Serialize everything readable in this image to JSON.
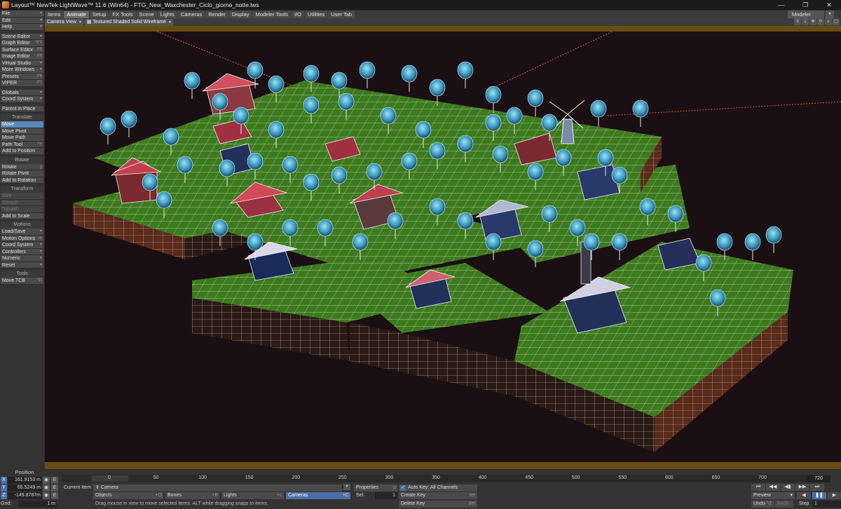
{
  "window": {
    "title": "Layout™ NewTek LightWave™ 11.6 (Win64) - FTG_New_Waxchester_Ciclo_giorno_notte.lws",
    "controls": [
      "—",
      "❐",
      "✕"
    ]
  },
  "tabs": [
    "Items",
    "Animate",
    "Setup",
    "FX Tools",
    "Scene",
    "Lights",
    "Cameras",
    "Render",
    "Display",
    "Modeler Tools",
    "I/O",
    "Utilities",
    "User Tab"
  ],
  "active_tab": "Animate",
  "modeler_button": "Modeler",
  "sidebar": {
    "top_menus": [
      {
        "label": "File",
        "shortcut": "▾"
      },
      {
        "label": "Edit",
        "shortcut": "▾"
      },
      {
        "label": "Help",
        "shortcut": "▾"
      }
    ],
    "editors": [
      {
        "label": "Scene Editor",
        "shortcut": "▾"
      },
      {
        "label": "Graph Editor",
        "shortcut": "^F2"
      },
      {
        "label": "Surface Editor",
        "shortcut": "F5"
      },
      {
        "label": "Image Editor",
        "shortcut": "F6"
      },
      {
        "label": "Virtual Studio",
        "shortcut": "▾"
      },
      {
        "label": "More Windows",
        "shortcut": "▾"
      },
      {
        "label": "Presets",
        "shortcut": "F8"
      },
      {
        "label": "VIPER",
        "shortcut": "F7"
      }
    ],
    "globals": [
      {
        "label": "Globals",
        "shortcut": "▾"
      },
      {
        "label": "Coord System",
        "shortcut": "▾"
      }
    ],
    "parent_in_place": "Parent in Place",
    "translate_header": "Translate",
    "translate": [
      {
        "label": "Move",
        "shortcut": "t",
        "active": true
      },
      {
        "label": "Move Pivot",
        "shortcut": ""
      },
      {
        "label": "Move Path",
        "shortcut": ""
      },
      {
        "label": "Path Tool",
        "shortcut": "^Y"
      },
      {
        "label": "Add to Position",
        "shortcut": ""
      }
    ],
    "rotate_header": "Rotate",
    "rotate": [
      {
        "label": "Rotate",
        "shortcut": "y"
      },
      {
        "label": "Rotate Pivot",
        "shortcut": ""
      },
      {
        "label": "Add to Rotation",
        "shortcut": ""
      }
    ],
    "transform_header": "Transform",
    "transform": [
      {
        "label": "Size",
        "shortcut": "",
        "dim": true
      },
      {
        "label": "Stretch",
        "shortcut": "",
        "dim": true
      },
      {
        "label": "Squash",
        "shortcut": "",
        "dim": true
      },
      {
        "label": "Add to Scale",
        "shortcut": ""
      }
    ],
    "motions_header": "Motions",
    "motions": [
      {
        "label": "Load/Save",
        "shortcut": "▾"
      },
      {
        "label": "Motion Options",
        "shortcut": "m"
      },
      {
        "label": "Coord System",
        "shortcut": "▾"
      },
      {
        "label": "Controllers",
        "shortcut": "▾"
      },
      {
        "label": "Numeric",
        "shortcut": "▾"
      },
      {
        "label": "Reset",
        "shortcut": "▾"
      }
    ],
    "tools_header": "Tools",
    "tools": [
      {
        "label": "Move TCB",
        "shortcut": "^G"
      }
    ]
  },
  "viewport": {
    "view_mode": "Camera View",
    "render_style": "Textured Shaded Solid Wireframe"
  },
  "position": {
    "label": "Position",
    "x": "161.9153 m",
    "y": "65.5249 m",
    "z": "-149.8787m",
    "grid_label": "Grid:",
    "grid_value": "1 m"
  },
  "timeline": {
    "start": "0",
    "current": "0",
    "end": "720",
    "ticks": [
      "0",
      "50",
      "100",
      "150",
      "200",
      "250",
      "300",
      "350",
      "400",
      "450",
      "500",
      "550",
      "600",
      "650",
      "700"
    ]
  },
  "current_item": {
    "label": "Current Item",
    "value": "Camera",
    "properties": "Properties",
    "properties_key": "p",
    "sel_label": "Sel:",
    "sel_value": "1"
  },
  "filters": {
    "objects": "Objects",
    "objects_key": "+O",
    "bones": "Bones",
    "bones_key": "+B",
    "lights": "Lights",
    "lights_key": "+L",
    "cameras": "Cameras",
    "cameras_key": "+C"
  },
  "status_hint": "Drag mouse in view to move selected items. ALT while dragging snaps to items.",
  "keys": {
    "auto_key": "Auto Key: All Channels",
    "create_key": "Create Key",
    "create_key_shortcut": "ret",
    "delete_key": "Delete Key",
    "delete_key_shortcut": "del"
  },
  "playback": {
    "preview": "Preview",
    "undo": "Undo",
    "undo_key": "^Z",
    "redo": "Redo",
    "step_label": "Step",
    "step_value": "1"
  },
  "colors": {
    "accent_blue": "#4a6fa5",
    "gold_bar": "#6a4c12",
    "viewport_bg": "#1a0f12",
    "grass": "#3d7a1e",
    "wire": "#e6e6e6"
  }
}
